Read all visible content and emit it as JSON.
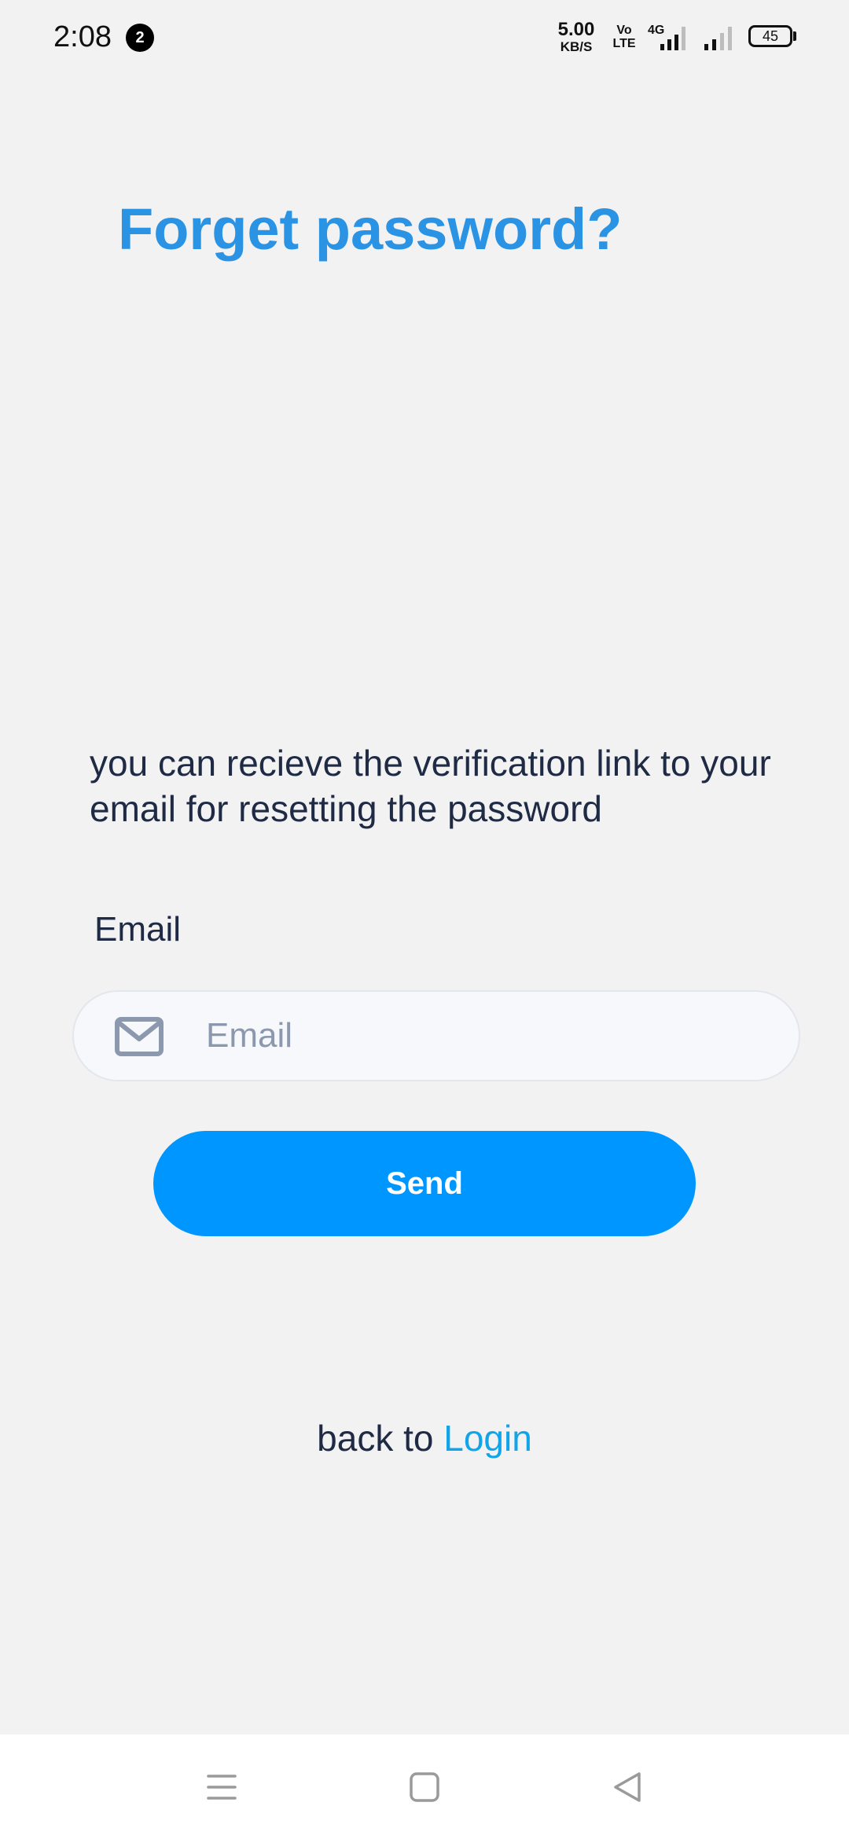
{
  "status_bar": {
    "time": "2:08",
    "notification_count": "2",
    "net_speed_value": "5.00",
    "net_speed_unit": "KB/S",
    "volte_top": "Vo",
    "volte_bottom": "LTE",
    "network_type": "4G",
    "battery_level": "45"
  },
  "page": {
    "title": "Forget password?",
    "description": "you can recieve the verification link to your email for resetting the password",
    "email_label": "Email",
    "email_placeholder": "Email",
    "email_value": "",
    "send_label": "Send",
    "back_prefix": "back to",
    "login_link": "Login"
  },
  "icons": {
    "email_field": "mail-icon",
    "nav_menu": "menu-icon",
    "nav_home": "home-square-icon",
    "nav_back": "back-triangle-icon"
  },
  "colors": {
    "background": "#f2f2f2",
    "title": "#2a93e4",
    "primary_button": "#0096ff",
    "link": "#12a4e8",
    "text": "#1f2a44",
    "placeholder": "#8b98ad"
  }
}
